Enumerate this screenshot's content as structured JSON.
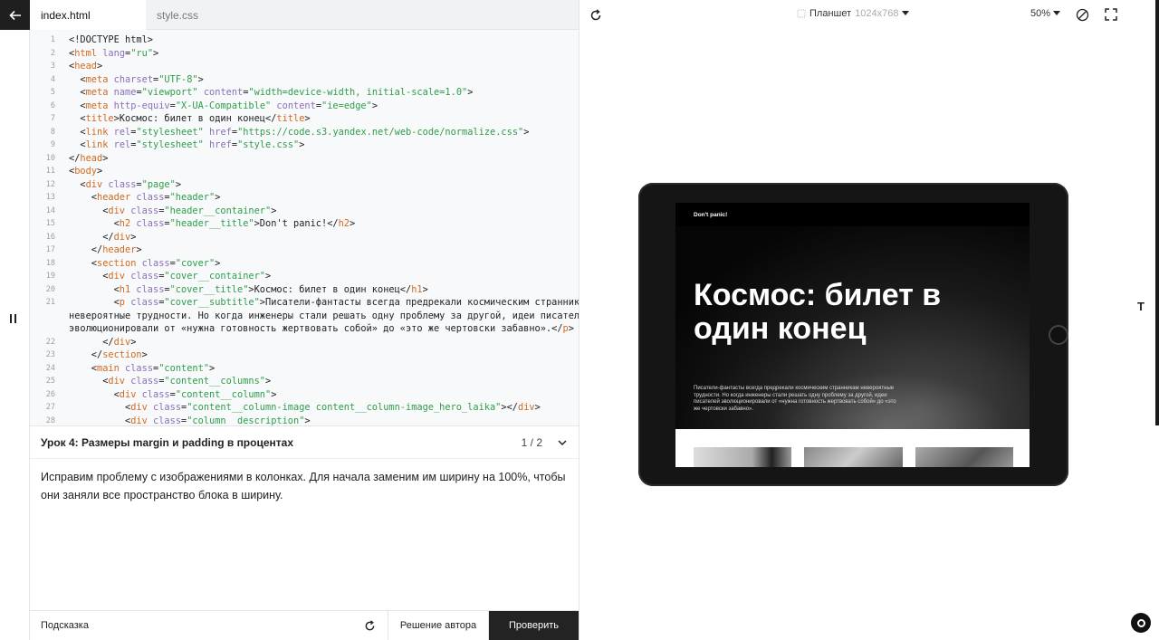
{
  "editor": {
    "tabs": [
      {
        "label": "index.html",
        "active": true
      },
      {
        "label": "style.css",
        "active": false
      }
    ],
    "lines": [
      {
        "n": "1",
        "html": "&lt;!DOCTYPE html&gt;"
      },
      {
        "n": "2",
        "html": "&lt;<span class='t'>html</span> <span class='a'>lang</span>=<span class='s'>\"ru\"</span>&gt;"
      },
      {
        "n": "3",
        "html": "&lt;<span class='t'>head</span>&gt;"
      },
      {
        "n": "4",
        "html": "  &lt;<span class='t'>meta</span> <span class='a'>charset</span>=<span class='s'>\"UTF-8\"</span>&gt;"
      },
      {
        "n": "5",
        "html": "  &lt;<span class='t'>meta</span> <span class='a'>name</span>=<span class='s'>\"viewport\"</span> <span class='a'>content</span>=<span class='s'>\"width=device-width, initial-scale=1.0\"</span>&gt;"
      },
      {
        "n": "6",
        "html": "  &lt;<span class='t'>meta</span> <span class='a'>http-equiv</span>=<span class='s'>\"X-UA-Compatible\"</span> <span class='a'>content</span>=<span class='s'>\"ie=edge\"</span>&gt;"
      },
      {
        "n": "7",
        "html": "  &lt;<span class='t'>title</span>&gt;Космос: билет в один конец&lt;/<span class='t'>title</span>&gt;"
      },
      {
        "n": "8",
        "html": "  &lt;<span class='t'>link</span> <span class='a'>rel</span>=<span class='s'>\"stylesheet\"</span> <span class='a'>href</span>=<span class='s'>\"https://code.s3.yandex.net/web-code/normalize.css\"</span>&gt;"
      },
      {
        "n": "9",
        "html": "  &lt;<span class='t'>link</span> <span class='a'>rel</span>=<span class='s'>\"stylesheet\"</span> <span class='a'>href</span>=<span class='s'>\"style.css\"</span>&gt;"
      },
      {
        "n": "10",
        "html": "&lt;/<span class='t'>head</span>&gt;"
      },
      {
        "n": "11",
        "html": "&lt;<span class='t'>body</span>&gt;"
      },
      {
        "n": "12",
        "html": "  &lt;<span class='t'>div</span> <span class='a'>class</span>=<span class='s'>\"page\"</span>&gt;"
      },
      {
        "n": "13",
        "html": "    &lt;<span class='t'>header</span> <span class='a'>class</span>=<span class='s'>\"header\"</span>&gt;"
      },
      {
        "n": "14",
        "html": "      &lt;<span class='t'>div</span> <span class='a'>class</span>=<span class='s'>\"header__container\"</span>&gt;"
      },
      {
        "n": "15",
        "html": "        &lt;<span class='t'>h2</span> <span class='a'>class</span>=<span class='s'>\"header__title\"</span>&gt;Don't panic!&lt;/<span class='t'>h2</span>&gt;"
      },
      {
        "n": "16",
        "html": "      &lt;/<span class='t'>div</span>&gt;"
      },
      {
        "n": "17",
        "html": "    &lt;/<span class='t'>header</span>&gt;"
      },
      {
        "n": "18",
        "html": "    &lt;<span class='t'>section</span> <span class='a'>class</span>=<span class='s'>\"cover\"</span>&gt;"
      },
      {
        "n": "19",
        "html": "      &lt;<span class='t'>div</span> <span class='a'>class</span>=<span class='s'>\"cover__container\"</span>&gt;"
      },
      {
        "n": "20",
        "html": "        &lt;<span class='t'>h1</span> <span class='a'>class</span>=<span class='s'>\"cover__title\"</span>&gt;Космос: билет в один конец&lt;/<span class='t'>h1</span>&gt;"
      },
      {
        "n": "21",
        "html": "        &lt;<span class='t'>p</span> <span class='a'>class</span>=<span class='s'>\"cover__subtitle\"</span>&gt;Писатели-фантасты всегда предрекали космическим странникам"
      },
      {
        "n": "",
        "html": "невероятные трудности. Но когда инженеры стали решать одну проблему за другой, идеи писателей"
      },
      {
        "n": "",
        "html": "эволюционировали от «нужна готовность жертвовать собой» до «это же чертовски забавно».&lt;/<span class='t'>p</span>&gt;"
      },
      {
        "n": "22",
        "html": "      &lt;/<span class='t'>div</span>&gt;"
      },
      {
        "n": "23",
        "html": "    &lt;/<span class='t'>section</span>&gt;"
      },
      {
        "n": "24",
        "html": "    &lt;<span class='t'>main</span> <span class='a'>class</span>=<span class='s'>\"content\"</span>&gt;"
      },
      {
        "n": "25",
        "html": "      &lt;<span class='t'>div</span> <span class='a'>class</span>=<span class='s'>\"content__columns\"</span>&gt;"
      },
      {
        "n": "26",
        "html": "        &lt;<span class='t'>div</span> <span class='a'>class</span>=<span class='s'>\"content__column\"</span>&gt;"
      },
      {
        "n": "27",
        "html": "          &lt;<span class='t'>div</span> <span class='a'>class</span>=<span class='s'>\"content__column-image content__column-image_hero_laika\"</span>&gt;&lt;/<span class='t'>div</span>&gt;"
      },
      {
        "n": "28",
        "html": "          &lt;<span class='t'>div</span> <span class='a'>class</span>=<span class='s'>\"column__description\"</span>&gt;"
      }
    ]
  },
  "lesson": {
    "title": "Урок 4: Размеры margin и padding в процентах",
    "page": "1 / 2",
    "text": "Исправим проблему с изображениями в колонках. Для начала заменим им ширину на 100%, чтобы они заняли все пространство блока в ширину."
  },
  "bottom": {
    "hint": "Подсказка",
    "author": "Решение автора",
    "check": "Проверить"
  },
  "preview": {
    "device": "Планшет",
    "resolution": "1024x768",
    "zoom": "50%",
    "site": {
      "header": "Don't panic!",
      "title": "Космос: билет в один конец",
      "subtitle": "Писатели-фантасты всегда предрекали космическим странникам невероятные трудности. Но когда инженеры стали решать одну проблему за другой, идеи писателей эволюционировали от «нужна готовность жертвовать собой» до «это же чертовски забавно»."
    }
  },
  "side": {
    "t_label": "T"
  }
}
